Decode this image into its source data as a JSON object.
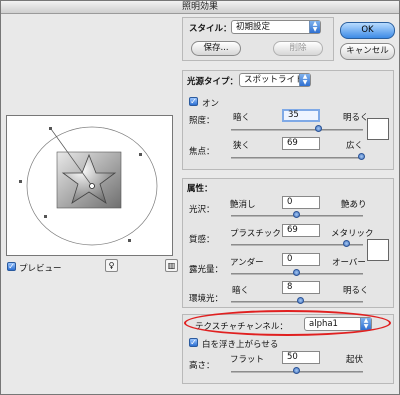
{
  "window": {
    "title": "照明効果"
  },
  "style": {
    "label": "スタイル：",
    "value": "初期設定",
    "save_label": "保存...",
    "delete_label": "削除"
  },
  "buttons": {
    "ok": "OK",
    "cancel": "キャンセル"
  },
  "light_type": {
    "label": "光源タイプ：",
    "value": "スポットライト",
    "on_label": "オン",
    "on_checked": true,
    "intensity": {
      "label": "照度：",
      "left": "暗く",
      "right": "明るく",
      "value": "35",
      "fraction": 0.67
    },
    "focus": {
      "label": "焦点：",
      "left": "狭く",
      "right": "広く",
      "value": "69",
      "fraction": 0.99
    }
  },
  "properties": {
    "header": "属性：",
    "gloss": {
      "label": "光沢：",
      "left": "艶消し",
      "right": "艶あり",
      "value": "0",
      "fraction": 0.5
    },
    "material": {
      "label": "質感：",
      "left": "プラスチック",
      "right": "メタリック",
      "value": "69",
      "fraction": 0.88
    },
    "exposure": {
      "label": "露光量：",
      "left": "アンダー",
      "right": "オーバー",
      "value": "0",
      "fraction": 0.5
    },
    "ambience": {
      "label": "環境光：",
      "left": "暗く",
      "right": "明るく",
      "value": "8",
      "fraction": 0.53
    }
  },
  "texture": {
    "channel_label": "テクスチャチャンネル：",
    "channel_value": "alpha1",
    "white_high_label": "白を浮き上がらせる",
    "white_high_checked": true,
    "height": {
      "label": "高さ：",
      "left": "フラット",
      "right": "起伏",
      "value": "50",
      "fraction": 0.5
    }
  },
  "preview": {
    "label": "プレビュー",
    "checked": true
  },
  "colors": {
    "accent": "#3d7fd8",
    "highlight_oval": "#e02020"
  }
}
